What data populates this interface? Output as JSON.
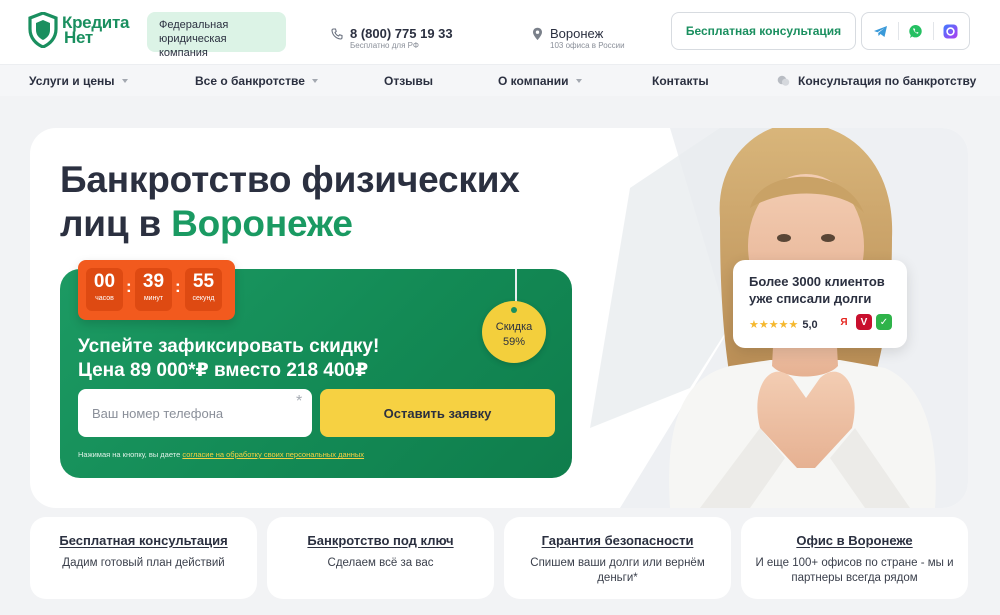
{
  "header": {
    "logo_line1": "Кредита",
    "logo_line2": "Нет",
    "badge": "Федеральная юридическая компания",
    "phone": "8 (800) 775 19 33",
    "phone_sub": "Бесплатно для РФ",
    "city": "Воронеж",
    "city_sub": "103 офиса в России",
    "consult_button": "Бесплатная консультация",
    "socials": [
      "telegram-icon",
      "whatsapp-icon",
      "max-messenger-icon"
    ]
  },
  "nav": {
    "items": [
      {
        "label": "Услуги и цены",
        "dropdown": true
      },
      {
        "label": "Все о банкротстве",
        "dropdown": true
      },
      {
        "label": "Отзывы",
        "dropdown": false
      },
      {
        "label": "О компании",
        "dropdown": true
      },
      {
        "label": "Контакты",
        "dropdown": false
      },
      {
        "label": "Консультация по банкротству",
        "dropdown": false
      }
    ]
  },
  "hero": {
    "title_line1": "Банкротство физических",
    "title_line2_prefix": "лиц в ",
    "title_city": "Воронеже",
    "timer": {
      "hours": "00",
      "hours_label": "часов",
      "minutes": "39",
      "minutes_label": "минут",
      "seconds": "55",
      "seconds_label": "секунд"
    },
    "promo_line1": "Успейте зафиксировать скидку!",
    "promo_line2": "Цена 89 000*₽ вместо 218 400₽",
    "discount_label": "Скидка",
    "discount_value": "59%",
    "phone_placeholder": "Ваш номер телефона",
    "required_mark": "*",
    "submit_button": "Оставить заявку",
    "consent_prefix": "Нажимая на кнопку, вы даете ",
    "consent_link": "согласие на обработку своих персональных данных",
    "clients_text": "Более 3000 клиентов уже списали долги",
    "rating_stars": 5,
    "rating": "5,0",
    "review_sources": [
      "yandex-icon",
      "review-v-icon",
      "green-review-icon"
    ]
  },
  "features": [
    {
      "title": "Бесплатная консультация",
      "desc": "Дадим готовый план действий"
    },
    {
      "title": "Банкротство под ключ",
      "desc": "Сделаем всё за вас"
    },
    {
      "title": "Гарантия безопасности",
      "desc": "Спишем ваши долги или вернём деньги*"
    },
    {
      "title": "Офис в Воронеже",
      "desc": "И еще 100+ офисов по стране - мы и партнеры всегда рядом"
    }
  ],
  "colors": {
    "brand_green": "#1a9a62",
    "accent_yellow": "#f6d142",
    "timer_orange": "#f25a1e"
  }
}
